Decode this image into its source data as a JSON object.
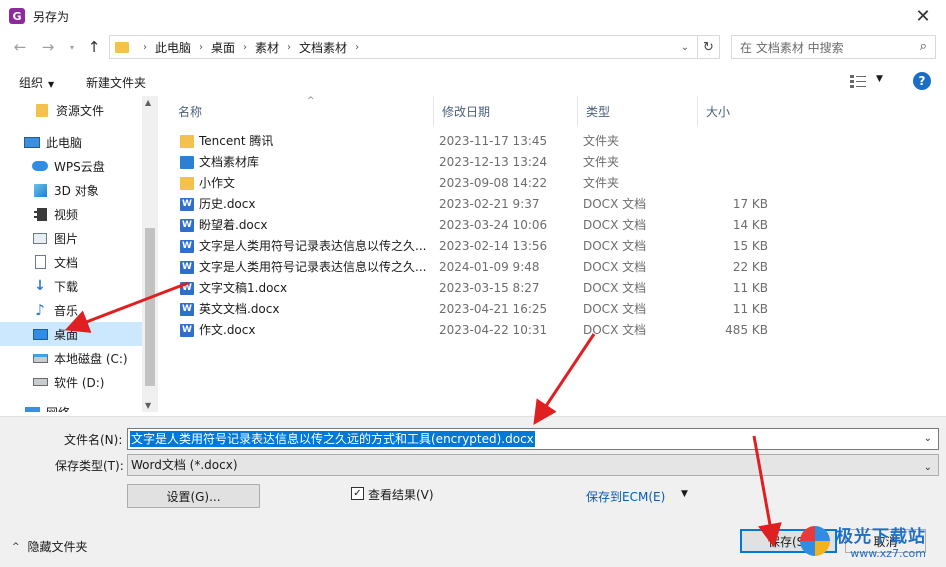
{
  "window": {
    "title": "另存为",
    "app_icon_glyph": "G",
    "accent": "#0078d7",
    "selection": "#cce8ff"
  },
  "breadcrumb": [
    "此电脑",
    "桌面",
    "素材",
    "文档素材"
  ],
  "search": {
    "placeholder": "在 文档素材 中搜索"
  },
  "toolbar": {
    "organize": "组织",
    "new_folder": "新建文件夹",
    "help": "?"
  },
  "nav_pane": [
    {
      "label": "资源文件",
      "icon": "folder-icon",
      "indent": true
    },
    {
      "label": "此电脑",
      "icon": "computer-icon",
      "indent": false
    },
    {
      "label": "WPS云盘",
      "icon": "cloud-icon",
      "indent": true
    },
    {
      "label": "3D 对象",
      "icon": "cube-icon",
      "indent": true
    },
    {
      "label": "视频",
      "icon": "video-icon",
      "indent": true
    },
    {
      "label": "图片",
      "icon": "picture-icon",
      "indent": true
    },
    {
      "label": "文档",
      "icon": "document-icon",
      "indent": true
    },
    {
      "label": "下载",
      "icon": "download-icon",
      "indent": true
    },
    {
      "label": "音乐",
      "icon": "music-icon",
      "indent": true
    },
    {
      "label": "桌面",
      "icon": "desktop-icon",
      "indent": true,
      "selected": true
    },
    {
      "label": "本地磁盘 (C:)",
      "icon": "drive-icon",
      "indent": true
    },
    {
      "label": "软件 (D:)",
      "icon": "drive-icon",
      "indent": true
    },
    {
      "label": "网络",
      "icon": "network-icon",
      "indent": false
    }
  ],
  "columns": {
    "name": "名称",
    "date": "修改日期",
    "type": "类型",
    "size": "大小"
  },
  "files": [
    {
      "name": "Tencent 腾讯",
      "date": "2023-11-17 13:45",
      "type": "文件夹",
      "size": "",
      "icon": "folder"
    },
    {
      "name": "文档素材库",
      "date": "2023-12-13 13:24",
      "type": "文件夹",
      "size": "",
      "icon": "library"
    },
    {
      "name": "小作文",
      "date": "2023-09-08 14:22",
      "type": "文件夹",
      "size": "",
      "icon": "folder"
    },
    {
      "name": "历史.docx",
      "date": "2023-02-21 9:37",
      "type": "DOCX 文档",
      "size": "17 KB",
      "icon": "doc"
    },
    {
      "name": "盼望着.docx",
      "date": "2023-03-24 10:06",
      "type": "DOCX 文档",
      "size": "14 KB",
      "icon": "doc"
    },
    {
      "name": "文字是人类用符号记录表达信息以传之久...",
      "date": "2023-02-14 13:56",
      "type": "DOCX 文档",
      "size": "15 KB",
      "icon": "doc"
    },
    {
      "name": "文字是人类用符号记录表达信息以传之久...",
      "date": "2024-01-09 9:48",
      "type": "DOCX 文档",
      "size": "22 KB",
      "icon": "doc"
    },
    {
      "name": "文字文稿1.docx",
      "date": "2023-03-15 8:27",
      "type": "DOCX 文档",
      "size": "11 KB",
      "icon": "doc"
    },
    {
      "name": "英文文档.docx",
      "date": "2023-04-21 16:25",
      "type": "DOCX 文档",
      "size": "11 KB",
      "icon": "doc"
    },
    {
      "name": "作文.docx",
      "date": "2023-04-22 10:31",
      "type": "DOCX 文档",
      "size": "485 KB",
      "icon": "doc"
    }
  ],
  "form": {
    "filename_label": "文件名(N):",
    "filename_value": "文字是人类用符号记录表达信息以传之久远的方式和工具(encrypted).docx",
    "type_label": "保存类型(T):",
    "type_value": "Word文档 (*.docx)",
    "settings_button": "设置(G)...",
    "view_result": "查看结果(V)",
    "save_to_ecm": "保存到ECM(E)",
    "save_button": "保存(S)",
    "cancel_button": "取消",
    "hide_folders": "隐藏文件夹"
  },
  "watermark": {
    "brand": "极光下载站",
    "url": "www.xz7.com"
  }
}
